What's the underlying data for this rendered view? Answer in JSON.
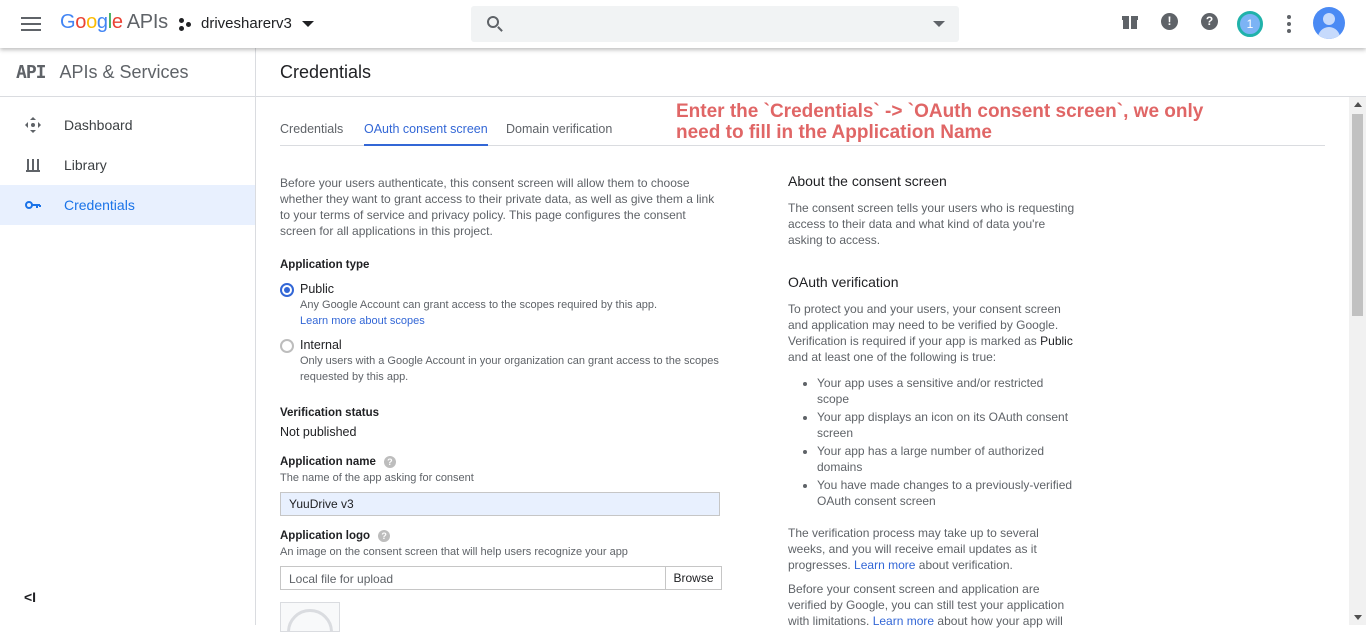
{
  "header": {
    "logo": {
      "g1": "G",
      "g2": "o",
      "g3": "o",
      "g4": "g",
      "g5": "l",
      "g6": "e",
      "apis": "APIs"
    },
    "project_name": "drivesharerv3",
    "search_placeholder": "",
    "notification_count": "1",
    "icons": [
      "menu-icon",
      "project-icon",
      "search-icon",
      "gift-icon",
      "feedback-icon",
      "help-icon",
      "notifications-icon",
      "more-vert-icon",
      "account-icon"
    ]
  },
  "sidebar": {
    "api_mark": "API",
    "title": "APIs & Services",
    "items": [
      {
        "label": "Dashboard",
        "icon": "dashboard-icon"
      },
      {
        "label": "Library",
        "icon": "library-icon"
      },
      {
        "label": "Credentials",
        "icon": "key-icon",
        "active": true
      }
    ],
    "collapse_glyph": "<I"
  },
  "page": {
    "title": "Credentials",
    "tabs": [
      {
        "label": "Credentials"
      },
      {
        "label": "OAuth consent screen",
        "active": true
      },
      {
        "label": "Domain verification"
      }
    ],
    "annotation": "Enter the `Credentials` -> `OAuth consent screen`, we only need to fill in the Application Name",
    "annotation_color": "#e06666"
  },
  "form": {
    "intro": "Before your users authenticate, this consent screen will allow them to choose whether they want to grant access to their private data, as well as give them a link to your terms of service and privacy policy. This page configures the consent screen for all applications in this project.",
    "app_type_label": "Application type",
    "public_title": "Public",
    "public_desc": "Any Google Account can grant access to the scopes required by this app.",
    "public_link": "Learn more about scopes",
    "internal_title": "Internal",
    "internal_desc": "Only users with a Google Account in your organization can grant access to the scopes requested by this app.",
    "verification_label": "Verification status",
    "verification_value": "Not published",
    "app_name_label": "Application name",
    "app_name_desc": "The name of the app asking for consent",
    "app_name_value": "YuuDrive v3",
    "app_logo_label": "Application logo",
    "app_logo_desc": "An image on the consent screen that will help users recognize your app",
    "file_placeholder": "Local file for upload",
    "browse_label": "Browse"
  },
  "info": {
    "about_title": "About the consent screen",
    "about_text": "The consent screen tells your users who is requesting access to their data and what kind of data you're asking to access.",
    "oauth_title": "OAuth verification",
    "oauth_text_1": "To protect you and your users, your consent screen and application may need to be verified by Google. Verification is required if your app is marked as",
    "oauth_public": "Public",
    "oauth_text_2": "and at least one of the following is true:",
    "list": [
      "Your app uses a sensitive and/or restricted scope",
      "Your app displays an icon on its OAuth consent screen",
      "Your app has a large number of authorized domains",
      "You have made changes to a previously-verified OAuth consent screen"
    ],
    "process_text_1": "The verification process may take up to several weeks, and you will receive email updates as it progresses.",
    "process_link": "Learn more",
    "process_text_2": "about verification.",
    "before_text_1": "Before your consent screen and application are verified by Google, you can still test your application with limitations.",
    "before_link": "Learn more",
    "before_text_2": "about how your app will"
  }
}
